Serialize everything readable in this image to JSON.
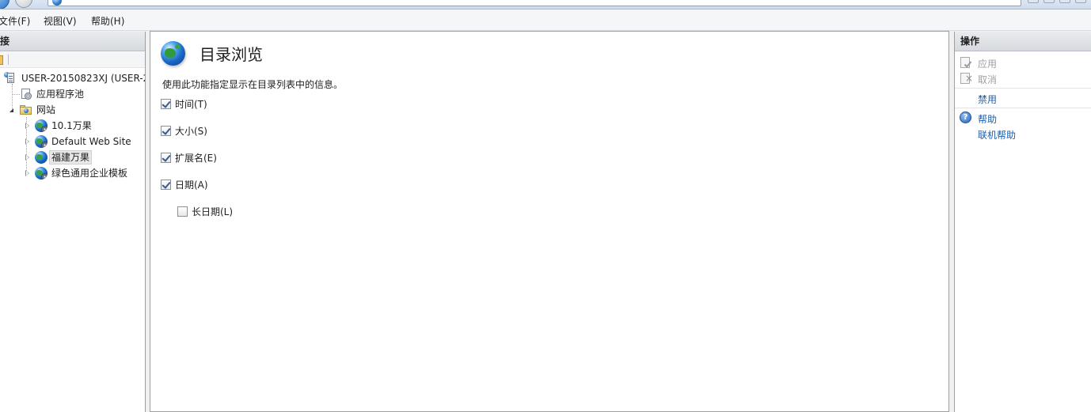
{
  "menu": {
    "file": "文件(F)",
    "view": "视图(V)",
    "help": "帮助(H)"
  },
  "connections": {
    "header": "连接",
    "tree": {
      "server": "USER-20150823XJ (USER-2",
      "app_pools": "应用程序池",
      "sites": "网站",
      "site_items": [
        "10.1万果",
        "Default Web Site",
        "福建万果",
        "绿色通用企业模板"
      ],
      "selected": "福建万果"
    }
  },
  "main": {
    "title": "目录浏览",
    "description": "使用此功能指定显示在目录列表中的信息。",
    "options": [
      {
        "label": "时间(T)",
        "checked": true
      },
      {
        "label": "大小(S)",
        "checked": true
      },
      {
        "label": "扩展名(E)",
        "checked": true
      },
      {
        "label": "日期(A)",
        "checked": true
      },
      {
        "label": "长日期(L)",
        "checked": false
      }
    ]
  },
  "actions": {
    "header": "操作",
    "apply": "应用",
    "cancel": "取消",
    "disable": "禁用",
    "help": "帮助",
    "online_help": "联机帮助"
  },
  "colors": {
    "link": "#1b5fae",
    "disabled": "#a0a0a0",
    "pane_header": "#d6d9de"
  }
}
